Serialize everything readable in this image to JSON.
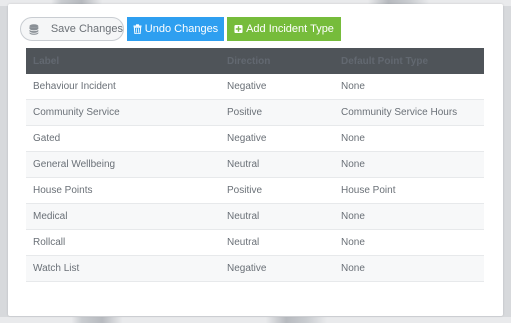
{
  "toolbar": {
    "save_label": "Save Changes",
    "undo_label": "Undo Changes",
    "add_label": "Add Incident Type",
    "save_icon": "database-icon",
    "undo_icon": "trash-icon",
    "add_icon": "plus-square-icon",
    "undo_color": "#2e9ff0",
    "add_color": "#76bc3b"
  },
  "table": {
    "headers": [
      "Label",
      "Direction",
      "Default Point Type"
    ],
    "rows": [
      {
        "label": "Behaviour Incident",
        "direction": "Negative",
        "point_type": "None"
      },
      {
        "label": "Community Service",
        "direction": "Positive",
        "point_type": "Community Service Hours"
      },
      {
        "label": "Gated",
        "direction": "Negative",
        "point_type": "None"
      },
      {
        "label": "General Wellbeing",
        "direction": "Neutral",
        "point_type": "None"
      },
      {
        "label": "House Points",
        "direction": "Positive",
        "point_type": "House Point"
      },
      {
        "label": "Medical",
        "direction": "Neutral",
        "point_type": "None"
      },
      {
        "label": "Rollcall",
        "direction": "Neutral",
        "point_type": "None"
      },
      {
        "label": "Watch List",
        "direction": "Negative",
        "point_type": "None"
      }
    ]
  }
}
